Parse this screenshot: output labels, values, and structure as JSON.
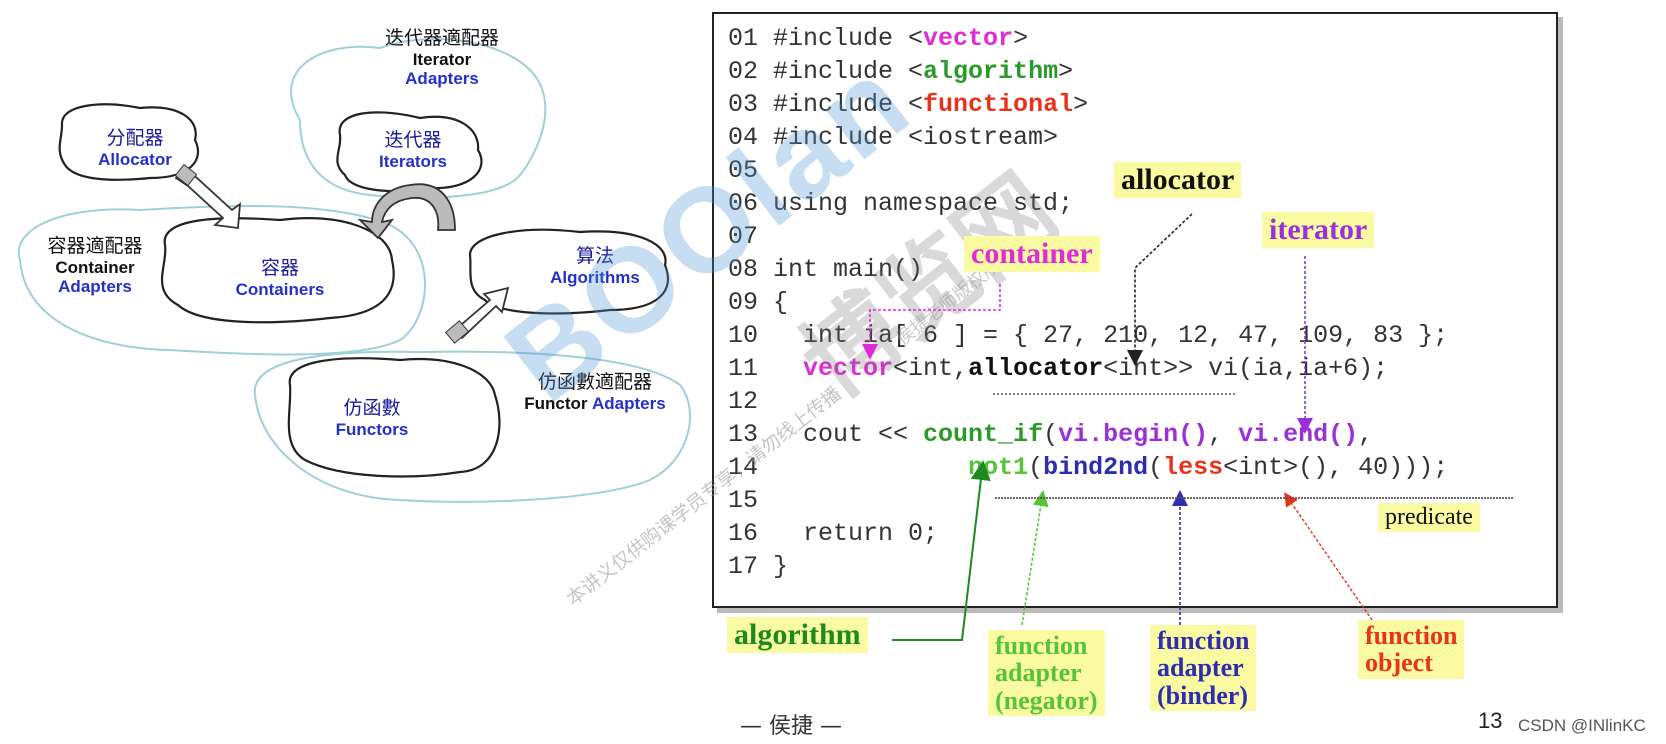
{
  "diagram": {
    "iterator_adapters": {
      "zh": "迭代器適配器",
      "en1": "Iterator",
      "en2": "Adapters"
    },
    "allocator": {
      "zh": "分配器",
      "en": "Allocator"
    },
    "iterators": {
      "zh": "迭代器",
      "en": "Iterators"
    },
    "container_adapters": {
      "zh": "容器適配器",
      "en1": "Container",
      "en2": "Adapters"
    },
    "containers": {
      "zh": "容器",
      "en": "Containers"
    },
    "algorithms": {
      "zh": "算法",
      "en": "Algorithms"
    },
    "functor_adapters": {
      "zh": "仿函數適配器",
      "en1": "Functor",
      "en2": "Adapters"
    },
    "functors": {
      "zh": "仿函數",
      "en": "Functors"
    }
  },
  "code": {
    "l01": {
      "num": "01",
      "pre": " #include <",
      "kw": "vector",
      "post": ">"
    },
    "l02": {
      "num": "02",
      "pre": " #include <",
      "kw": "algorithm",
      "post": ">"
    },
    "l03": {
      "num": "03",
      "pre": " #include <",
      "kw": "functional",
      "post": ">"
    },
    "l04": {
      "num": "04",
      "text": " #include <iostream>"
    },
    "l05": {
      "num": "05",
      "text": ""
    },
    "l06": {
      "num": "06",
      "text": " using namespace std;"
    },
    "l07": {
      "num": "07",
      "text": ""
    },
    "l08": {
      "num": "08",
      "text": " int main()"
    },
    "l09": {
      "num": "09",
      "text": " {"
    },
    "l10": {
      "num": "10",
      "text": "   int ia[ 6 ] = { 27, 210, 12, 47, 109, 83 };"
    },
    "l11": {
      "num": "11",
      "indent": "   ",
      "vector": "vector",
      "mid": "<int,",
      "allocator": "allocator",
      "post": "<int>> vi(ia,ia+6);"
    },
    "l12": {
      "num": "12",
      "text": ""
    },
    "l13": {
      "num": "13",
      "indent": "   cout << ",
      "count_if": "count_if",
      "p1": "(",
      "begin": "vi.begin()",
      "comma": ", ",
      "end": "vi.end()",
      "tail": ","
    },
    "l14": {
      "num": "14",
      "indent": "              ",
      "not1": "not1",
      "p1": "(",
      "bind2nd": "bind2nd",
      "p2": "(",
      "less": "less",
      "tail": "<int>(), 40)));"
    },
    "l15": {
      "num": "15",
      "text": ""
    },
    "l16": {
      "num": "16",
      "text": "   return 0;"
    },
    "l17": {
      "num": "17",
      "text": " }"
    }
  },
  "tags": {
    "allocator": "allocator",
    "iterator": "iterator",
    "container": "container",
    "predicate": "predicate",
    "algorithm": "algorithm",
    "negator_l1": "function",
    "negator_l2": "adapter",
    "negator_l3": "(negator)",
    "binder_l1": "function",
    "binder_l2": "adapter",
    "binder_l3": "(binder)",
    "fobj_l1": "function",
    "fobj_l2": "object"
  },
  "watermark": {
    "brand": "BOOlan",
    "zh": "博览网",
    "small1": "本讲义仅供购课学员专享，请勿线上传播",
    "small2": "侯捷老师版权所有"
  },
  "footer": {
    "author": "— 侯捷 —",
    "page": "13",
    "credit": "CSDN @INlinKC"
  },
  "colors": {
    "magenta": "#e12ad8",
    "green": "#2a9a2a",
    "red": "#e8321a",
    "blue": "#2d2db0",
    "light_green": "#55c43a",
    "tag_bg": "#fafaa2"
  }
}
